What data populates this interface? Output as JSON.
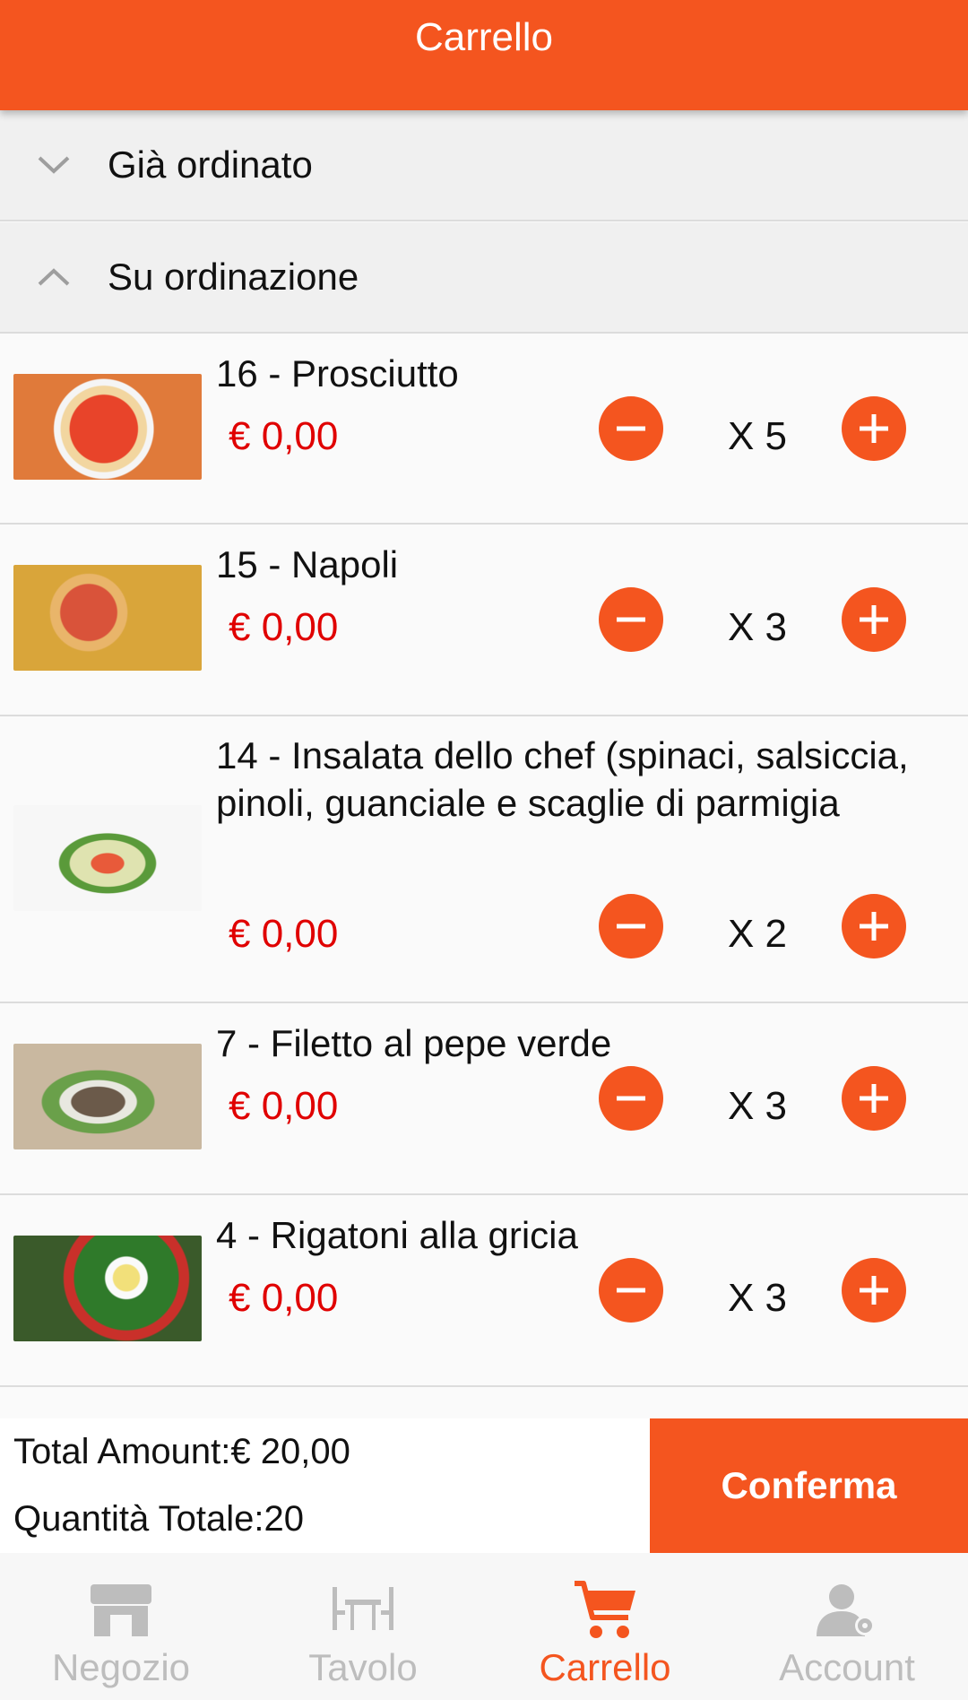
{
  "header": {
    "title": "Carrello"
  },
  "sections": {
    "ordered": {
      "label": "Già ordinato"
    },
    "pending": {
      "label": "Su ordinazione"
    }
  },
  "items": [
    {
      "name": "16 - Prosciutto",
      "price": "€ 0,00",
      "qty": "X 5"
    },
    {
      "name": "15 - Napoli",
      "price": "€ 0,00",
      "qty": "X 3"
    },
    {
      "name": "14 - Insalata dello chef (spinaci, salsiccia, pinoli, guanciale e scaglie di parmigia",
      "price": "€ 0,00",
      "qty": "X 2"
    },
    {
      "name": "7 - Filetto al pepe verde",
      "price": "€ 0,00",
      "qty": "X 3"
    },
    {
      "name": "4 - Rigatoni alla gricia",
      "price": "€ 0,00",
      "qty": "X 3"
    }
  ],
  "footer": {
    "total_amount": "Total Amount:€ 20,00",
    "total_quantity": "Quantità Totale:20",
    "confirm_label": "Conferma"
  },
  "nav": {
    "shop": "Negozio",
    "table": "Tavolo",
    "cart": "Carrello",
    "account": "Account"
  },
  "colors": {
    "accent": "#f4551f",
    "price": "#e00000",
    "inactive": "#bdbdbd"
  }
}
